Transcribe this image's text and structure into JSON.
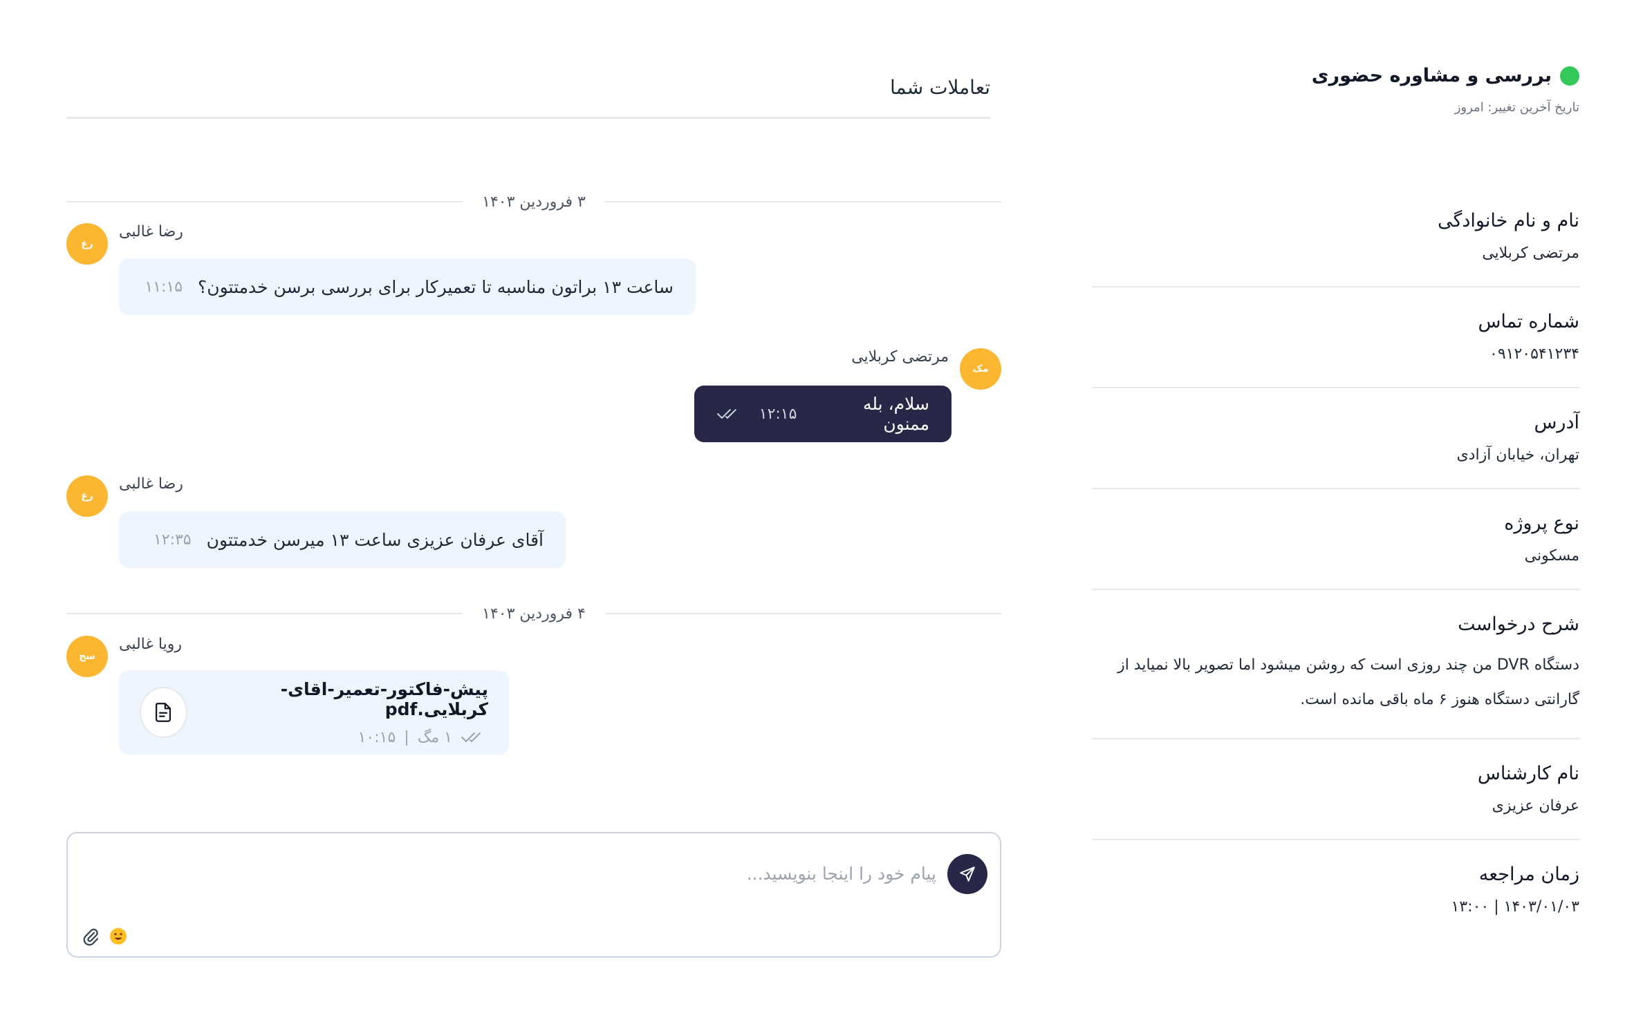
{
  "info": {
    "title": "بررسی و مشاوره حضوری",
    "subtitle": "تاریخ آخرین تغییر: امروز",
    "fields": [
      {
        "label": "نام و نام خانوادگی",
        "value": "مرتضی کربلایی"
      },
      {
        "label": "شماره تماس",
        "value": "۰۹۱۲۰۵۴۱۲۳۴"
      },
      {
        "label": "آدرس",
        "value": "تهران، خیابان آزادی"
      },
      {
        "label": "نوع پروژه",
        "value": "مسکونی"
      },
      {
        "label": "شرح درخواست",
        "value": "دستگاه DVR من چند روزی است که روشن میشود اما تصویر بالا نمیاید از گارانتی دستگاه هنوز ۶ ماه باقی مانده است."
      },
      {
        "label": "نام کارشناس",
        "value": "عرفان عزیزی"
      },
      {
        "label": "زمان مراجعه",
        "value": "۱۴۰۳/۰۱/۰۳ | ۱۳:۰۰"
      }
    ]
  },
  "chat": {
    "title": "تعاملات شما",
    "day1": "۳ فروردین ۱۴۰۳",
    "day2": "۴ فروردین ۱۴۰۳",
    "messages": [
      {
        "avatar": "رغ",
        "sender": "رضا غالبی",
        "text": "ساعت ۱۳ براتون مناسبه تا تعمیرکار برای بررسی برسن خدمتتون؟",
        "time": "۱۱:۱۵"
      },
      {
        "avatar": "مک",
        "sender": "مرتضی کربلایی",
        "text": "سلام، بله ممنون",
        "time": "۱۲:۱۵"
      },
      {
        "avatar": "رغ",
        "sender": "رضا غالبی",
        "text": "آقای عرفان عزیزی ساعت ۱۳ میرسن خدمتتون",
        "time": "۱۲:۳۵"
      }
    ],
    "file_message": {
      "avatar": "سج",
      "sender": "رویا غالبی",
      "file_name": "پیش-فاکتور-تعمیر-اقای-کربلایی.pdf",
      "size": "۱ مگ",
      "separator": "|",
      "time": "۱۰:۱۵"
    },
    "composer": {
      "placeholder": "پیام خود را اینجا بنویسید..."
    }
  },
  "colors": {
    "accent_dark": "#272847",
    "avatar": "#fbb731",
    "bubble_in": "#eef5ff",
    "status": "#34c759"
  }
}
